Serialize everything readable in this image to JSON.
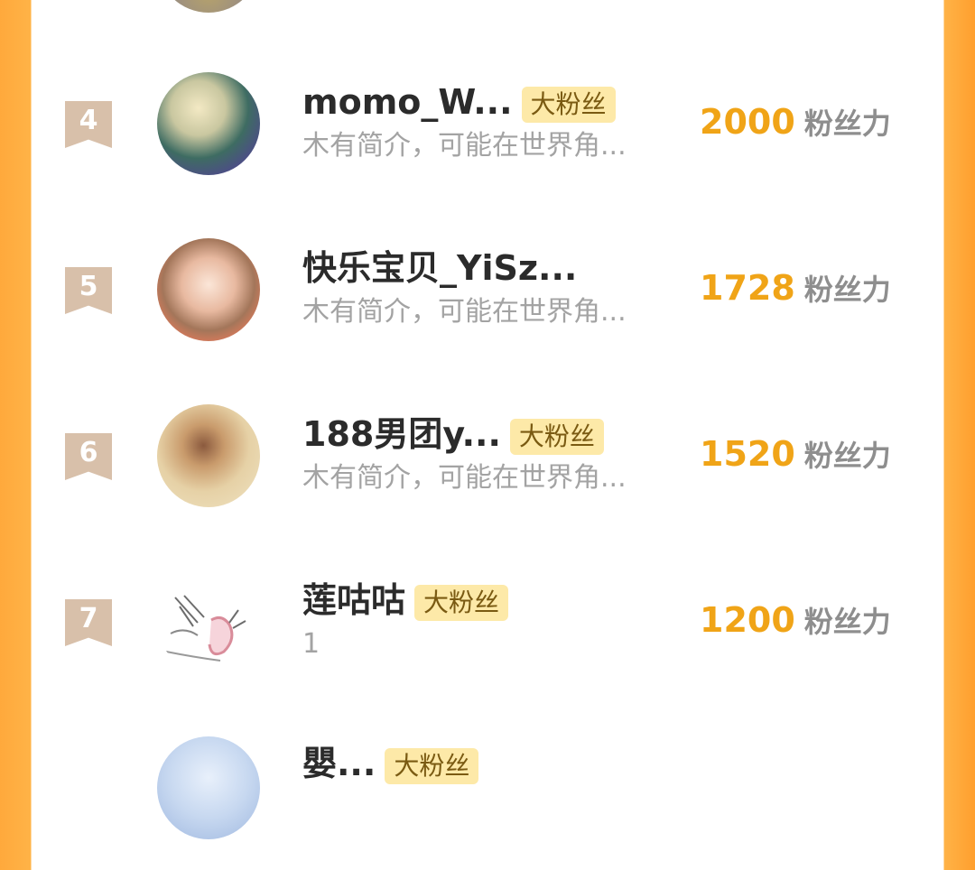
{
  "rows": [
    {
      "rank": "4",
      "name": "momo_W...",
      "badge": "大粉丝",
      "bio": "木有简介，可能在世界角...",
      "score": "2000",
      "unit": "粉丝力"
    },
    {
      "rank": "5",
      "name": "快乐宝贝_YiSz...",
      "badge": "",
      "bio": "木有简介，可能在世界角...",
      "score": "1728",
      "unit": "粉丝力"
    },
    {
      "rank": "6",
      "name": "188男团y...",
      "badge": "大粉丝",
      "bio": "木有简介，可能在世界角...",
      "score": "1520",
      "unit": "粉丝力"
    },
    {
      "rank": "7",
      "name": "莲咕咕",
      "badge": "大粉丝",
      "bio": "1",
      "score": "1200",
      "unit": "粉丝力"
    },
    {
      "rank": "",
      "name": "嬰...",
      "badge": "大粉丝",
      "bio": "",
      "score": "",
      "unit": ""
    }
  ],
  "colors": {
    "accent": "#f0a417",
    "badge_bg": "#fde9a8",
    "side_orange": "#ffa93c"
  }
}
